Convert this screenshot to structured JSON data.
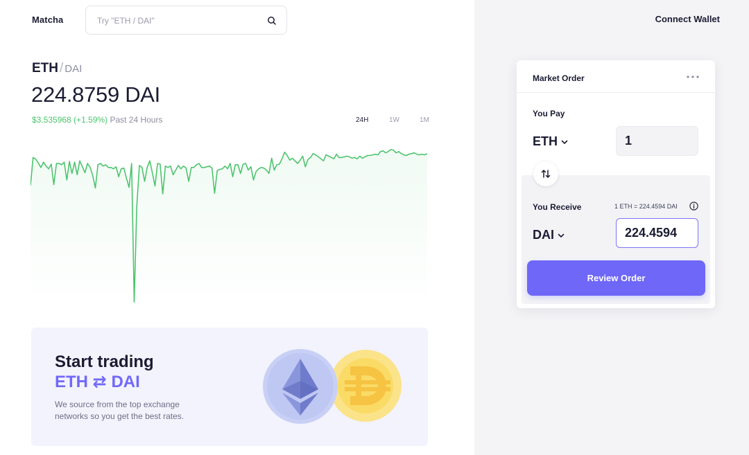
{
  "header": {
    "brand": "Matcha",
    "search_placeholder": "Try \"ETH / DAI\"",
    "connect_wallet": "Connect Wallet"
  },
  "market": {
    "base": "ETH",
    "separator": "/",
    "quote": "DAI",
    "price": "224.8759 DAI",
    "change": "$3.535968 (+1.59%)",
    "period": "Past 24 Hours",
    "ranges": [
      {
        "label": "24H",
        "active": true
      },
      {
        "label": "1W",
        "active": false
      },
      {
        "label": "1M",
        "active": false
      }
    ]
  },
  "colors": {
    "accent": "#6f67f7",
    "positive": "#4dc46e",
    "panel_bg": "#f4f4f6"
  },
  "chart_data": {
    "type": "line",
    "title": "",
    "xlabel": "",
    "ylabel": "",
    "grid": false,
    "series": [
      {
        "values": [
          203.0,
          224.0,
          222.8,
          219.9,
          216.5,
          220.5,
          217.5,
          215.5,
          219.0,
          203.5,
          219.5,
          219.5,
          218.5,
          220.5,
          207.0,
          221.0,
          212.0,
          220.5,
          211.0,
          221.5,
          217.0,
          212.5,
          219.5,
          216.5,
          210.5,
          201.0,
          218.5,
          219.5,
          217.5,
          218.5,
          216.5,
          216.5,
          215.5,
          217.0,
          209.5,
          215.5,
          216.0,
          208.5,
          201.5,
          219.5,
          188.0,
          218.0,
          216.5,
          206.0,
          216.5,
          221.5,
          212.5,
          202.5,
          219.5,
          219.0,
          196.5,
          217.5,
          216.5,
          217.5,
          211.0,
          214.5,
          218.0,
          215.5,
          217.5,
          216.0,
          206.0,
          216.5,
          216.5,
          218.5,
          219.5,
          216.5,
          216.5,
          217.0,
          217.5,
          216.0,
          197.0,
          214.0,
          215.0,
          215.5,
          217.5,
          215.5,
          219.5,
          209.5,
          218.5,
          218.5,
          212.0,
          219.0,
          219.5,
          214.5,
          217.0,
          207.0,
          213.5,
          215.5,
          216.5,
          216.0,
          214.5,
          212.0,
          223.5,
          214.5,
          218.5,
          219.0,
          223.0,
          228.0,
          225.5,
          222.0,
          223.5,
          221.5,
          219.5,
          222.0,
          225.0,
          217.0,
          222.5,
          224.0,
          227.0,
          226.0,
          224.5,
          223.0,
          221.5,
          226.0,
          225.0,
          224.0,
          223.0,
          226.5,
          224.0,
          224.0,
          224.5,
          225.0,
          224.5,
          223.5,
          224.0,
          223.0,
          225.0,
          223.5,
          224.5,
          225.5,
          225.5,
          226.0,
          226.5,
          226.0,
          228.5,
          229.0,
          227.5,
          228.5,
          230.0,
          229.5,
          227.5,
          228.5,
          227.0,
          226.0,
          225.5,
          226.5,
          227.0,
          227.5,
          226.5,
          226.0,
          226.5,
          226.0,
          227.0
        ]
      }
    ],
    "spike": {
      "index": 40,
      "value": 115.0
    }
  },
  "promo": {
    "title": "Start trading",
    "pair": "ETH ⇄ DAI",
    "description": "We source from the top exchange networks so you get the best rates."
  },
  "order": {
    "title": "Market Order",
    "pay_label": "You Pay",
    "pay_token": "ETH",
    "pay_amount": "1",
    "receive_label": "You Receive",
    "rate": "1 ETH = 224.4594 DAI",
    "receive_token": "DAI",
    "receive_amount": "224.4594",
    "review_label": "Review Order"
  }
}
